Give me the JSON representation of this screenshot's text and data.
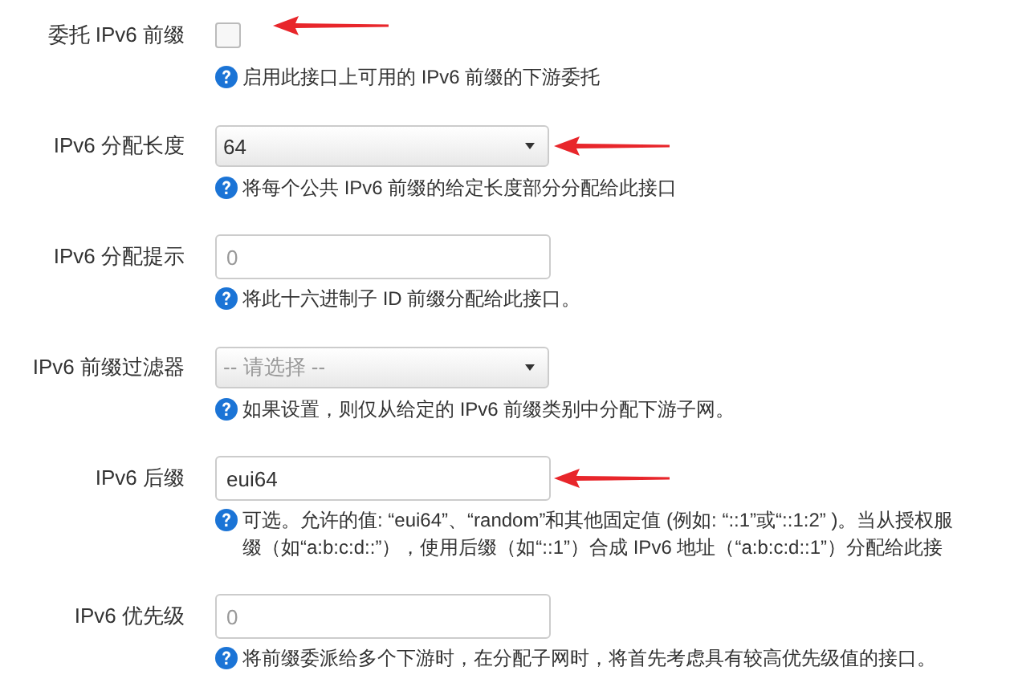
{
  "fields": [
    {
      "label": "委托 IPv6 前缀",
      "kind": "checkbox",
      "checked": false,
      "arrow": true,
      "help": [
        "启用此接口上可用的 IPv6 前缀的下游委托"
      ]
    },
    {
      "label": "IPv6 分配长度",
      "kind": "select",
      "value": "64",
      "arrow": true,
      "help": [
        "将每个公共 IPv6 前缀的给定长度部分分配给此接口"
      ]
    },
    {
      "label": "IPv6 分配提示",
      "kind": "input",
      "placeholder": "0",
      "arrow": false,
      "help": [
        "将此十六进制子 ID 前缀分配给此接口。"
      ]
    },
    {
      "label": "IPv6 前缀过滤器",
      "kind": "select",
      "placeholder": "-- 请选择 --",
      "arrow": false,
      "help": [
        "如果设置，则仅从给定的 IPv6 前缀类别中分配下游子网。"
      ]
    },
    {
      "label": "IPv6 后缀",
      "kind": "input",
      "value": "eui64",
      "arrow": true,
      "help": [
        "可选。允许的值: “eui64”、“random”和其他固定值 (例如: “::1”或“::1:2” )。当从授权服",
        "缀（如“a:b:c:d::”），使用后缀（如“::1”）合成 IPv6 地址（“a:b:c:d::1”）分配给此接"
      ]
    },
    {
      "label": "IPv6 优先级",
      "kind": "input",
      "placeholder": "0",
      "arrow": false,
      "help": [
        "将前缀委派给多个下游时，在分配子网时，将首先考虑具有较高优先级值的接口。"
      ]
    }
  ]
}
